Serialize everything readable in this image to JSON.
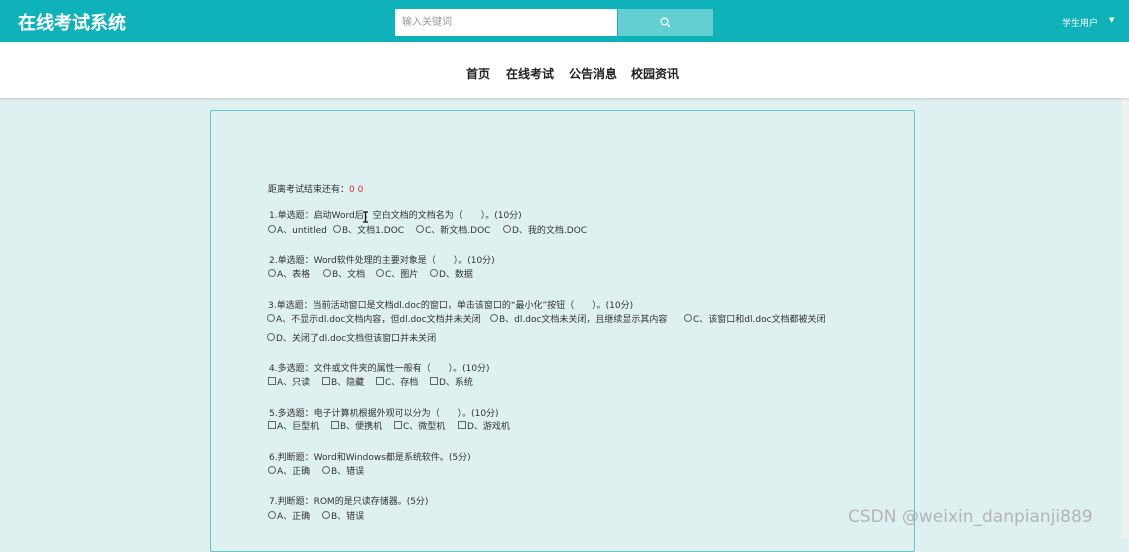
{
  "header": {
    "title": "在线考试系统",
    "search_placeholder": "输入关键词",
    "user_menu": "学生用户"
  },
  "nav": [
    "首页",
    "在线考试",
    "公告消息",
    "校园资讯"
  ],
  "exam": {
    "timer_label": "距离考试结束还有：",
    "timer_value": "0 0",
    "questions": [
      {
        "text": "1.单选题：启动Word后，空白文档的文档名为（　　）。(10分)",
        "type": "radio",
        "options": [
          "A、untitled",
          "B、文档1.DOC",
          "C、新文档.DOC",
          "D、我的文档.DOC"
        ]
      },
      {
        "text": "2.单选题：Word软件处理的主要对象是（　　）。(10分)",
        "type": "radio",
        "options": [
          "A、表格",
          "B、文档",
          "C、图片",
          "D、数据"
        ]
      },
      {
        "text": "3.单选题：当前活动窗口是文档dl.doc的窗口，单击该窗口的“最小化”按钮（　　）。(10分)",
        "type": "radio",
        "options": [
          "A、不显示dl.doc文档内容，但dl.doc文档并未关闭",
          "B、dl.doc文档未关闭，且继续显示其内容",
          "C、该窗口和dl.doc文档都被关闭",
          "D、关闭了dl.doc文档但该窗口并未关闭"
        ]
      },
      {
        "text": "4.多选题：文件或文件夹的属性一般有（　　）。(10分)",
        "type": "checkbox",
        "options": [
          "A、只读",
          "B、隐藏",
          "C、存档",
          "D、系统"
        ]
      },
      {
        "text": "5.多选题：电子计算机根据外观可以分为（　　）。(10分)",
        "type": "checkbox",
        "options": [
          "A、巨型机",
          "B、便携机",
          "C、微型机",
          "D、游戏机"
        ]
      },
      {
        "text": "6.判断题：Word和Windows都是系统软件。(5分)",
        "type": "radio",
        "options": [
          "A、正确",
          "B、错误"
        ]
      },
      {
        "text": "7.判断题：ROM的是只读存储器。(5分)",
        "type": "radio",
        "options": [
          "A、正确",
          "B、错误"
        ]
      }
    ]
  },
  "watermark": "CSDN @weixin_danpianji889",
  "colors": {
    "primary": "#0fb2b8",
    "search_button": "#62cfd3",
    "timer": "#e0312b",
    "background": "#dff0f0"
  },
  "icons": {
    "search": "search-icon",
    "caret": "caret-down-icon",
    "cursor": "text-cursor-icon"
  }
}
